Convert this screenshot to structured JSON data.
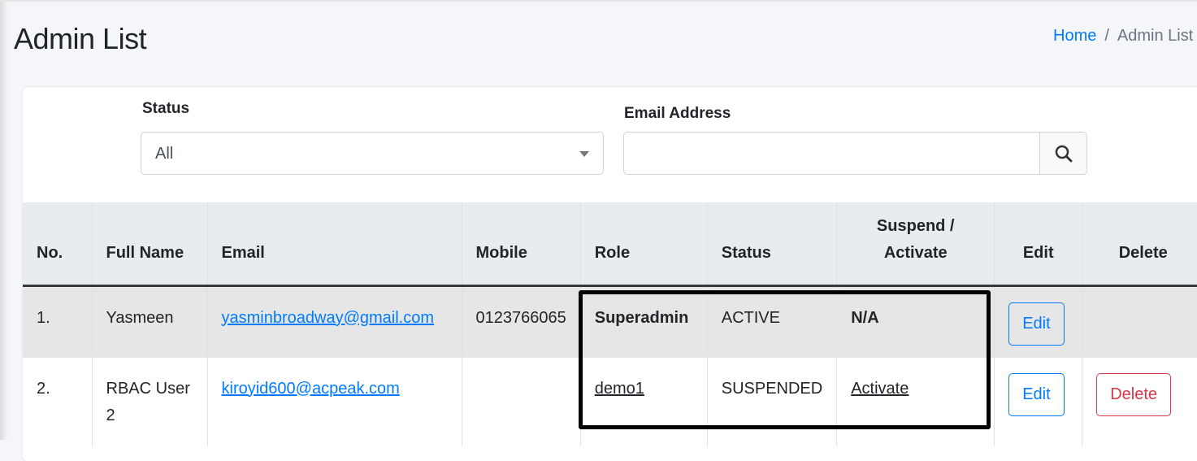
{
  "page": {
    "title": "Admin List"
  },
  "breadcrumb": {
    "home": "Home",
    "sep": "/",
    "current": "Admin List"
  },
  "filters": {
    "status_label": "Status",
    "status_value": "All",
    "email_label": "Email Address",
    "email_value": "",
    "email_placeholder": ""
  },
  "table": {
    "headers": {
      "no": "No.",
      "name": "Full Name",
      "email": "Email",
      "mobile": "Mobile",
      "role": "Role",
      "status": "Status",
      "suspend_1": "Suspend /",
      "suspend_2": "Activate",
      "edit": "Edit",
      "delete": "Delete"
    },
    "rows": [
      {
        "no": "1.",
        "name": "Yasmeen",
        "email": "yasminbroadway@gmail.com",
        "mobile": "0123766065",
        "role": "Superadmin",
        "status": "ACTIVE",
        "action": "N/A",
        "edit": "Edit"
      },
      {
        "no": "2.",
        "name": "RBAC User 2",
        "email": "kiroyid600@acpeak.com",
        "mobile": "",
        "role": "demo1",
        "status": "SUSPENDED",
        "action": "Activate",
        "edit": "Edit",
        "delete": "Delete"
      }
    ]
  },
  "colors": {
    "primary": "#007bff",
    "danger": "#dc3545",
    "highlight_box": "#000000"
  }
}
